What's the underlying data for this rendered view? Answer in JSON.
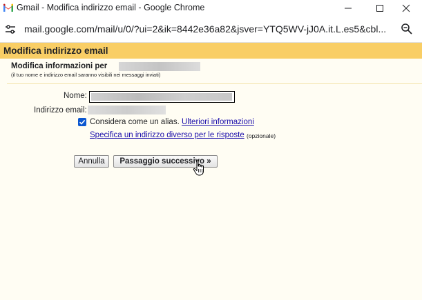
{
  "window": {
    "title": "Gmail - Modifica indirizzo email - Google Chrome"
  },
  "addressbar": {
    "url": "mail.google.com/mail/u/0/?ui=2&ik=8442e36a82&jsver=YTQ5WV-jJ0A.it.L.es5&cbl..."
  },
  "page": {
    "header_title": "Modifica indirizzo email",
    "section_title": "Modifica informazioni per",
    "section_note": "(il tuo nome e indirizzo email saranno visibili nei messaggi inviati)"
  },
  "form": {
    "name_label": "Nome:",
    "email_label": "Indirizzo email:",
    "alias_checked": true,
    "alias_text": "Considera come un alias.",
    "alias_link": "Ulteriori informazioni",
    "different_reply_link": "Specifica un indirizzo diverso per le risposte",
    "optional_note": "(opzionale)"
  },
  "buttons": {
    "cancel": "Annulla",
    "next": "Passaggio successivo »"
  },
  "colors": {
    "header_bg": "#f9ce65",
    "page_bg": "#fffdf3",
    "link": "#1a0dab",
    "checkbox": "#0b57d0"
  },
  "icons": {
    "app": "gmail-icon",
    "minimize": "minimize-icon",
    "maximize": "maximize-icon",
    "close": "close-icon",
    "site_settings": "tune-icon",
    "zoom": "zoom-icon",
    "cursor": "hand-pointer-icon"
  }
}
